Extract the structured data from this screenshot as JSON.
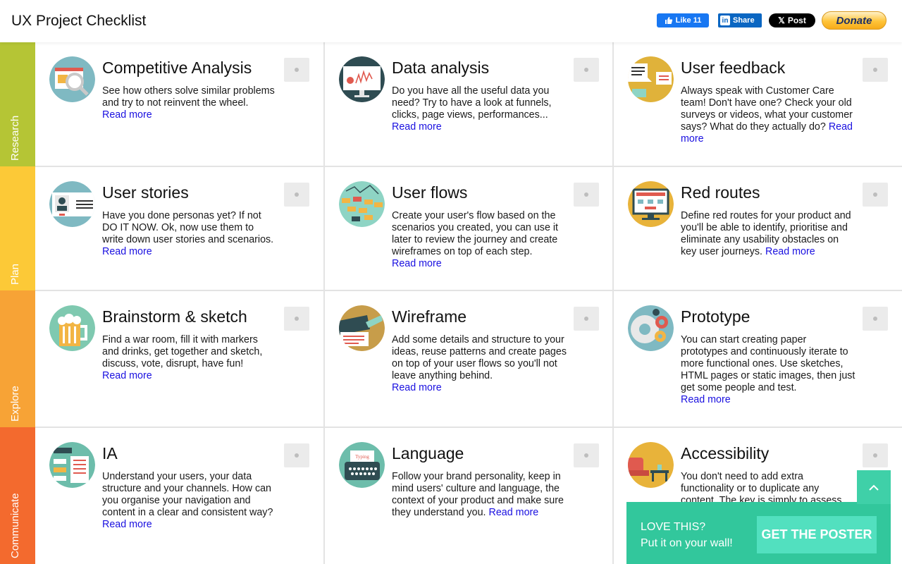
{
  "header": {
    "title": "UX Project Checklist",
    "like_label": "Like 11",
    "share_label": "Share",
    "post_label": "Post",
    "donate_label": "Donate"
  },
  "categories": [
    {
      "label": "Research",
      "color": "#b5c535"
    },
    {
      "label": "Plan",
      "color": "#fcc937"
    },
    {
      "label": "Explore",
      "color": "#f7a336"
    },
    {
      "label": "Communicate",
      "color": "#f36a2e"
    }
  ],
  "cards": [
    {
      "title": "Competitive Analysis",
      "text": "See how others solve similar problems and try to not reinvent the wheel.",
      "read_more": "Read more",
      "icon": "magnifier-icon",
      "color": "#7fb9c2"
    },
    {
      "title": "Data analysis",
      "text": "Do you have all the useful data you need? Try to have a look at funnels, clicks, page views, performances...",
      "read_more": "Read more",
      "icon": "monitor-chart-icon",
      "color": "#2f4c52"
    },
    {
      "title": "User feedback",
      "text": "Always speak with Customer Care team! Don't have one? Check your old surveys or videos, what your customer says? What do they actually do?",
      "read_more": "Read more",
      "icon": "speech-bubble-icon",
      "color": "#e0b23a"
    },
    {
      "title": "User stories",
      "text": "Have you done personas yet? If not DO IT NOW. Ok, now use them to write down user stories and scenarios.",
      "read_more": "Read more",
      "icon": "id-card-icon",
      "color": "#7fb9c2"
    },
    {
      "title": "User flows",
      "text": "Create your user's flow based on the scenarios you created, you can use it later to review the journey and create wireframes on top of each step.",
      "read_more": "Read more",
      "icon": "flowchart-icon",
      "color": "#8ed4c4"
    },
    {
      "title": "Red routes",
      "text": "Define red routes for your product and you'll be able to identify, prioritise and eliminate any usability obstacles on key user journeys.",
      "read_more": "Read more",
      "icon": "screen-routes-icon",
      "color": "#e8b33a"
    },
    {
      "title": "Brainstorm & sketch",
      "text": "Find a war room, fill it with markers and drinks, get together and sketch, discuss, vote, disrupt, have fun!",
      "read_more": "Read more",
      "icon": "beer-mug-icon",
      "color": "#7fc9b0"
    },
    {
      "title": "Wireframe",
      "text": "Add some details and structure to your ideas, reuse patterns and create pages on top of your user flows so you'll not leave anything behind.",
      "read_more": "Read more",
      "icon": "wireframe-icon",
      "color": "#c79d4a"
    },
    {
      "title": "Prototype",
      "text": "You can start creating paper prototypes and continuously iterate to more functional ones. Use sketches, HTML pages or static images, then just get some people and test.",
      "read_more": "Read more",
      "icon": "gears-icon",
      "color": "#7fb9c2"
    },
    {
      "title": "IA",
      "text": "Understand your users, your data structure and your channels. How can you organise your navigation and content in a clear and consistent way?",
      "read_more": "Read more",
      "icon": "sitemap-icon",
      "color": "#6dbdab"
    },
    {
      "title": "Language",
      "text": "Follow your brand personality, keep in mind users' culture and language, the context of your product and make sure they understand you.",
      "read_more": "Read more",
      "icon": "typewriter-icon",
      "color": "#6dbdab",
      "badge": "Typing"
    },
    {
      "title": "Accessibility",
      "text": "You don't need to add extra functionality or to duplicate any content. The key is simply to assess",
      "read_more": "",
      "icon": "armchair-icon",
      "color": "#e8b33a"
    }
  ],
  "poster": {
    "line1": "LOVE THIS?",
    "line2": "Put it on your wall!",
    "button_label": "GET THE POSTER"
  }
}
